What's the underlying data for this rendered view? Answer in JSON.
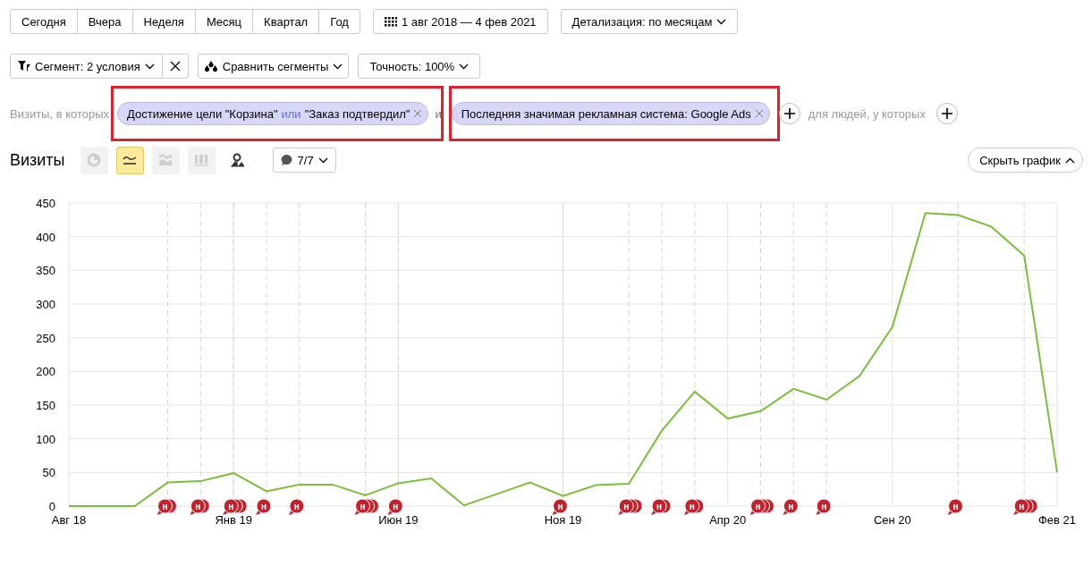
{
  "period_tabs": [
    {
      "label": "Сегодня",
      "selected": false
    },
    {
      "label": "Вчера",
      "selected": false
    },
    {
      "label": "Неделя",
      "selected": false
    },
    {
      "label": "Месяц",
      "selected": false
    },
    {
      "label": "Квартал",
      "selected": false
    },
    {
      "label": "Год",
      "selected": false
    }
  ],
  "date_range": {
    "label": "1 авг 2018 — 4 фев 2021"
  },
  "detail": {
    "label": "Детализация: по месяцам"
  },
  "segment": {
    "label": "Сегмент: 2 условия"
  },
  "compare": {
    "label": "Сравнить сегменты"
  },
  "accuracy": {
    "label": "Точность: 100%"
  },
  "conditions": {
    "visits_label": "Визиты, в которых",
    "joiner": "и",
    "people_label": "для людей, у которых",
    "items": [
      {
        "highlighted": true,
        "parts": [
          {
            "kind": "text",
            "text": "Достижение цели \"Корзина\""
          },
          {
            "kind": "operator",
            "text": "или"
          },
          {
            "kind": "text",
            "text": "\"Заказ подтвердил\""
          }
        ]
      },
      {
        "highlighted": true,
        "parts": [
          {
            "kind": "text",
            "text": "Последняя значимая рекламная система: Google Ads"
          }
        ]
      }
    ]
  },
  "chart_header": {
    "title": "Визиты",
    "chart_types": [
      {
        "kind": "pie",
        "selected": false,
        "disabled": true
      },
      {
        "kind": "line",
        "selected": true,
        "disabled": false
      },
      {
        "kind": "area",
        "selected": false,
        "disabled": true
      },
      {
        "kind": "bar",
        "selected": false,
        "disabled": true
      },
      {
        "kind": "map",
        "selected": false,
        "disabled": false
      }
    ],
    "notes_filter": "7/7",
    "hide_chart": "Скрыть график"
  },
  "chart": {
    "chart_data": {
      "type": "line",
      "categories": [
        "Авг 18",
        null,
        null,
        null,
        null,
        "Янв 19",
        null,
        null,
        null,
        null,
        "Июн 19",
        null,
        null,
        null,
        null,
        "Ноя 19",
        null,
        null,
        null,
        null,
        "Апр 20",
        null,
        null,
        null,
        null,
        "Сен 20",
        null,
        null,
        null,
        null,
        "Фев 21"
      ],
      "series": [
        {
          "color": "#7cbf3a",
          "values": [
            0,
            0,
            0,
            35,
            37,
            49,
            22,
            32,
            32,
            16,
            34,
            41,
            1,
            18,
            35,
            15,
            31,
            33,
            112,
            170,
            130,
            141,
            174,
            158,
            193,
            266,
            435,
            432,
            415,
            372,
            50
          ]
        }
      ],
      "ylim": [
        0,
        450
      ],
      "yticks": [
        0,
        50,
        100,
        150,
        200,
        250,
        300,
        350,
        400,
        450
      ],
      "grid": true
    },
    "notes": [
      {
        "kind": "none"
      },
      {
        "kind": "none"
      },
      {
        "kind": "none"
      },
      {
        "kind": "double",
        "text": "н"
      },
      {
        "kind": "double",
        "text": "н"
      },
      {
        "kind": "triple",
        "text": "н"
      },
      {
        "kind": "single",
        "text": "н"
      },
      {
        "kind": "single",
        "text": "н"
      },
      {
        "kind": "none"
      },
      {
        "kind": "triple",
        "text": "н"
      },
      {
        "kind": "single",
        "text": "н"
      },
      {
        "kind": "none"
      },
      {
        "kind": "none"
      },
      {
        "kind": "none"
      },
      {
        "kind": "none"
      },
      {
        "kind": "single",
        "text": "н"
      },
      {
        "kind": "none"
      },
      {
        "kind": "triple",
        "text": "н"
      },
      {
        "kind": "double",
        "text": "н"
      },
      {
        "kind": "double",
        "text": "н"
      },
      {
        "kind": "none"
      },
      {
        "kind": "triple",
        "text": "н"
      },
      {
        "kind": "single",
        "text": "н"
      },
      {
        "kind": "single",
        "text": "н"
      },
      {
        "kind": "none"
      },
      {
        "kind": "none"
      },
      {
        "kind": "none"
      },
      {
        "kind": "single",
        "text": "н"
      },
      {
        "kind": "none"
      },
      {
        "kind": "triple",
        "text": "н"
      },
      {
        "kind": "none"
      }
    ]
  }
}
